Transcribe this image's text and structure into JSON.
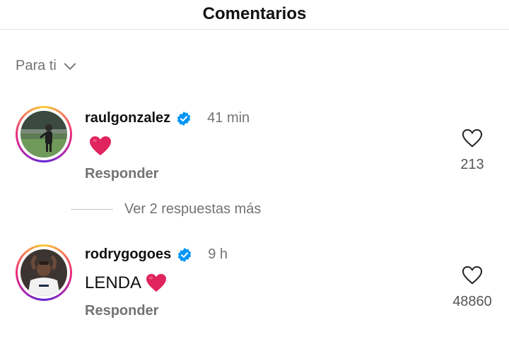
{
  "header": {
    "title": "Comentarios"
  },
  "sort": {
    "label": "Para ti",
    "icon": "chevron-down-icon"
  },
  "comments": [
    {
      "username": "raulgonzalez",
      "verified": true,
      "time": "41 min",
      "text": "",
      "emoji": "❤️",
      "reply_label": "Responder",
      "likes": "213"
    },
    {
      "username": "rodrygogoes",
      "verified": true,
      "time": "9 h",
      "text": "LENDA",
      "emoji": "❤️",
      "reply_label": "Responder",
      "likes": "48860"
    }
  ],
  "more_replies": {
    "label": "Ver 2 respuestas más"
  },
  "colors": {
    "verified": "#0095f6",
    "heart_emoji": "#e0245e",
    "secondary_text": "#737373"
  }
}
